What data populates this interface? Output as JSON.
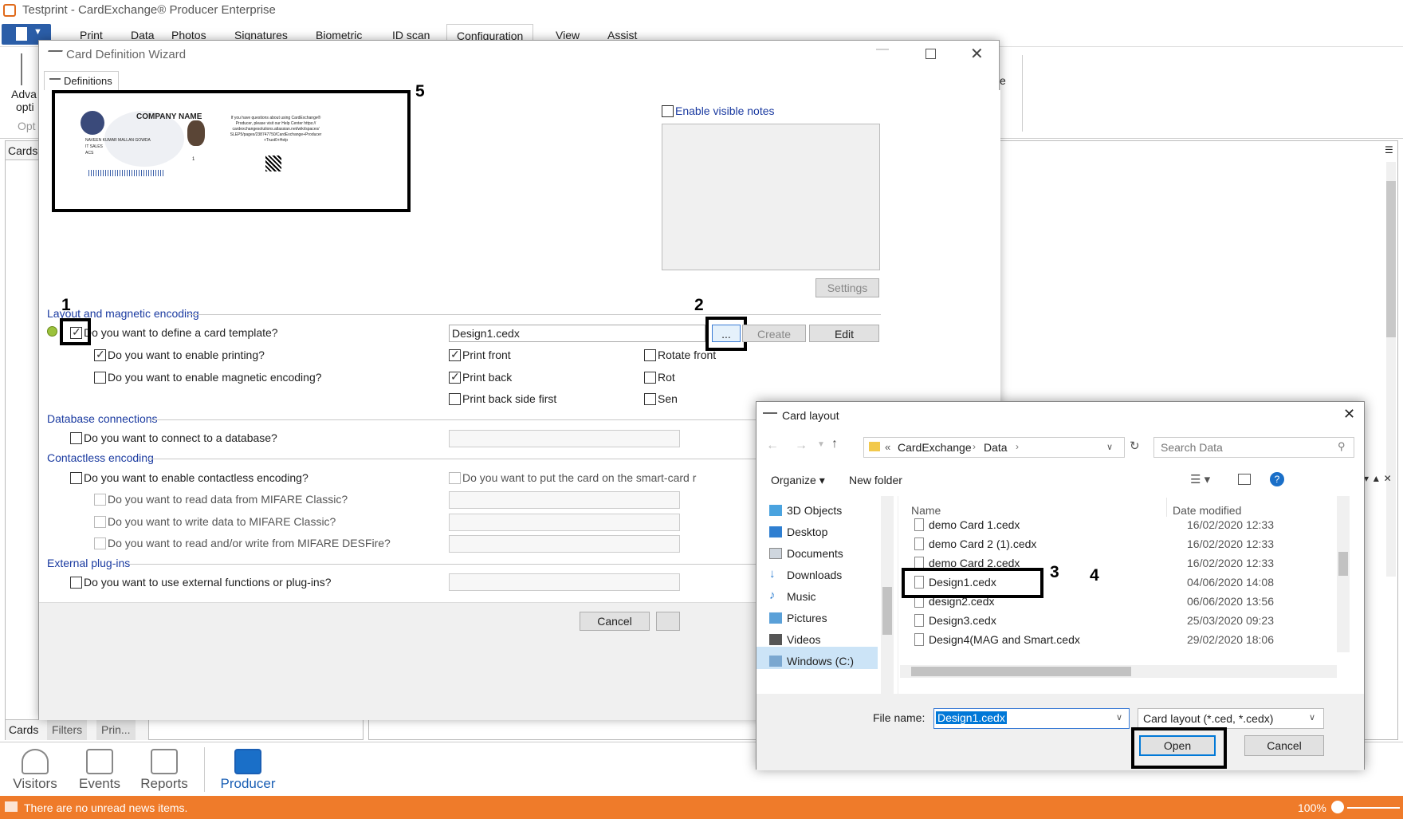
{
  "app": {
    "title": "Testprint - CardExchange® Producer Enterprise",
    "ribbon_tabs": [
      "Print",
      "Data",
      "Photos",
      "Signatures",
      "Biometric",
      "ID scan",
      "Configuration",
      "View",
      "Assist"
    ],
    "ribbon_group_label_1": "Adva",
    "ribbon_group_label_2": "opti",
    "ribbon_group_label_3": "Opt",
    "ribbon_right_fragment": "e",
    "left_tab": "Cards",
    "bottom_tabs": [
      "Cards",
      "Filters",
      "Prin..."
    ],
    "nav": [
      "Visitors",
      "Events",
      "Reports",
      "Producer"
    ],
    "status": "There are no unread news items.",
    "zoom": "100%"
  },
  "wizard": {
    "title": "Card Definition Wizard",
    "tab": "Definitions",
    "card_preview": {
      "company": "COMPANY NAME",
      "name": "NAVEEN KUMAR MALLAN GOWDA",
      "dept": "IT SALES",
      "line3": "ACS",
      "small_num": "1",
      "help_text": "If you have questions about using CardExchange® Producer, please visit our Help Center https:// cardexchangesolutions.atlassian.net/wiki/spaces/ SLEP5/pages/238747750/CardExchange+Producer +Trust0+Help"
    },
    "enable_notes": "Enable visible notes",
    "settings": "Settings",
    "sections": {
      "layout": "Layout and magnetic encoding",
      "database": "Database connections",
      "contactless": "Contactless encoding",
      "plugins": "External plug-ins"
    },
    "q_template": "Do you want to define a card template?",
    "q_printing": "Do you want to enable printing?",
    "q_magnetic": "Do you want to enable magnetic encoding?",
    "template_file": "Design1.cedx",
    "browse": "...",
    "create": "Create",
    "edit": "Edit",
    "print_front": "Print front",
    "print_back": "Print back",
    "print_back_first": "Print back side first",
    "rotate_front": "Rotate front",
    "rotate_back_frag": "Rot",
    "send_frag": "Sen",
    "q_database": "Do you want to connect to a database?",
    "q_contactless": "Do you want to enable contactless encoding?",
    "q_smartcard": "Do you want to put the card on the smart-card r",
    "q_mifare_read": "Do you want to read data from MIFARE Classic?",
    "q_mifare_write": "Do you want to write data to MIFARE Classic?",
    "q_desfire": "Do you want to read and/or write from MIFARE DESFire?",
    "q_plugins": "Do you want to use external functions or plug-ins?",
    "cancel": "Cancel"
  },
  "dialog": {
    "title": "Card layout",
    "breadcrumb": [
      "CardExchange",
      "Data"
    ],
    "search_placeholder": "Search Data",
    "organize": "Organize ▾",
    "new_folder": "New folder",
    "nav_items": [
      "3D Objects",
      "Desktop",
      "Documents",
      "Downloads",
      "Music",
      "Pictures",
      "Videos",
      "Windows (C:)"
    ],
    "col_name": "Name",
    "col_date": "Date modified",
    "files": [
      {
        "name": "demo Card 1.cedx",
        "date": "16/02/2020 12:33"
      },
      {
        "name": "demo Card 2 (1).cedx",
        "date": "16/02/2020 12:33"
      },
      {
        "name": "demo Card 2.cedx",
        "date": "16/02/2020 12:33"
      },
      {
        "name": "Design1.cedx",
        "date": "04/06/2020 14:08"
      },
      {
        "name": "design2.cedx",
        "date": "06/06/2020 13:56"
      },
      {
        "name": "Design3.cedx",
        "date": "25/03/2020 09:23"
      },
      {
        "name": "Design4(MAG and Smart.cedx",
        "date": "29/02/2020 18:06"
      }
    ],
    "filename_label": "File name:",
    "filename_value": "Design1.cedx",
    "filetype": "Card layout (*.ced, *.cedx)",
    "open": "Open",
    "cancel": "Cancel"
  },
  "annotations": [
    "1",
    "2",
    "3",
    "4",
    "5"
  ]
}
